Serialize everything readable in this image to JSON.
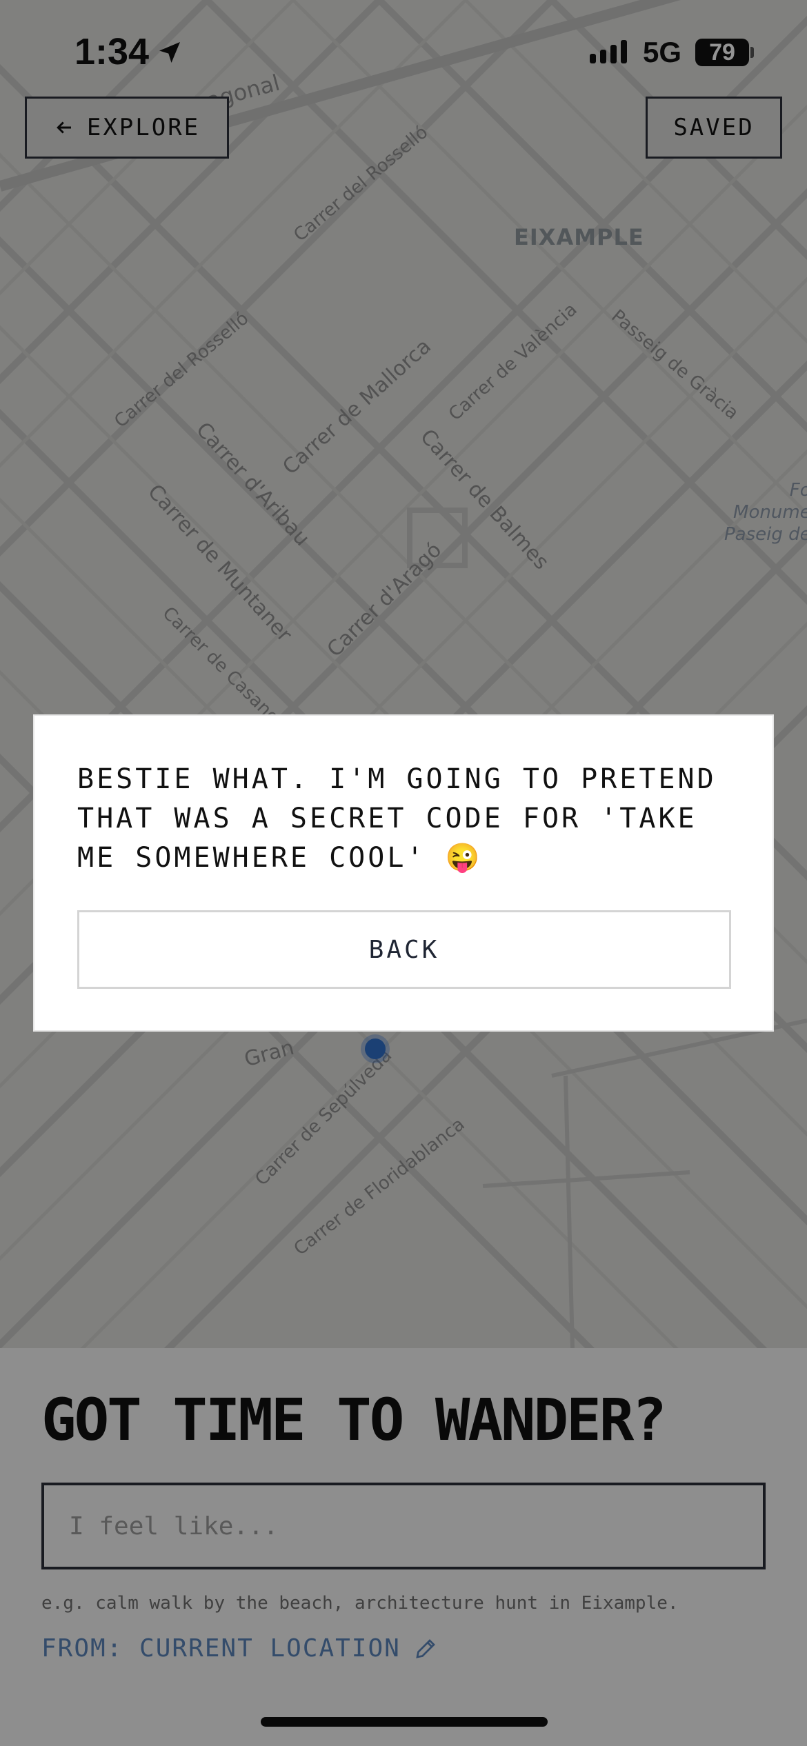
{
  "status_bar": {
    "time": "1:34",
    "network": "5G",
    "battery": "79"
  },
  "nav": {
    "explore_label": "EXPLORE",
    "saved_label": "SAVED"
  },
  "map": {
    "district": "EIXAMPLE",
    "streets": [
      "Carrer del Rosselló",
      "Carrer del Rosselló",
      "Carrer de Mallorca",
      "Carrer de València",
      "Passeig de Gràcia",
      "Carrer d'Aribau",
      "Carrer de Balmes",
      "Carrer de Muntaner",
      "Carrer d'Aragó",
      "Carrer de Casanova",
      "Carrer de Sepúlveda",
      "Carrer de Floridablanca",
      "agonal",
      "Gran"
    ],
    "poi": "Fo\nMonume\nPaseig de"
  },
  "dialog": {
    "message": "BESTIE WHAT. I'M GOING TO PRETEND THAT WAS A SECRET CODE FOR 'TAKE ME SOMEWHERE COOL' 😜",
    "back_label": "BACK"
  },
  "sheet": {
    "title": "GOT TIME TO WANDER?",
    "input_placeholder": "I feel like...",
    "input_value": "",
    "hint": "e.g. calm walk by the beach, architecture hunt in Eixample.",
    "from_label": "FROM: CURRENT LOCATION"
  },
  "colors": {
    "accent_blue": "#5a84b8",
    "location_dot": "#2f6fc8",
    "ink": "#111111"
  }
}
